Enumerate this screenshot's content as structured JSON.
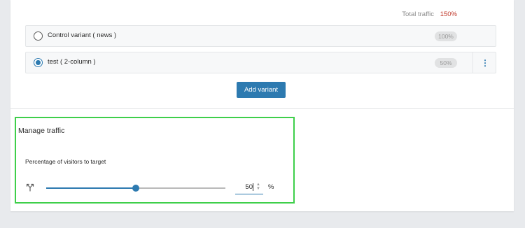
{
  "traffic": {
    "total_label": "Total traffic",
    "total_value": "150%"
  },
  "variants": [
    {
      "label": "Control variant ( news )",
      "percent": "100%",
      "selected": false
    },
    {
      "label": "test ( 2-column )",
      "percent": "50%",
      "selected": true
    }
  ],
  "actions": {
    "add_variant_label": "Add variant"
  },
  "manage_traffic": {
    "title": "Manage traffic",
    "visitors_label": "Percentage of visitors to target",
    "slider_percent": 50,
    "input_value": "50",
    "unit": "%"
  },
  "colors": {
    "accent": "#2d7ab0",
    "total_value": "#c0392b",
    "highlight": "#3ecf4a"
  },
  "icons": {
    "split": "split-arrows-icon",
    "more": "kebab-menu-icon"
  }
}
